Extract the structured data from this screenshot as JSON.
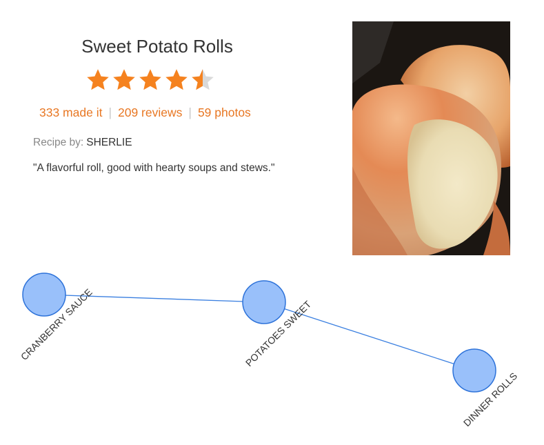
{
  "recipe": {
    "title": "Sweet Potato Rolls",
    "rating": 4.5,
    "rating_max": 5,
    "made_it": "333 made it",
    "reviews": "209 reviews",
    "photos": "59 photos",
    "by_label": "Recipe by:",
    "author": "SHERLIE",
    "description": "\"A flavorful roll, good with hearty soups and stews.\""
  },
  "colors": {
    "accent": "#e87723",
    "star_filled": "#f5821f",
    "star_empty": "#d9d9d9",
    "node_fill": "#99c0fa",
    "node_stroke": "#2d72d9",
    "edge": "#3a7fe0"
  },
  "graph": {
    "nodes": [
      "CRANBERRY SAUCE",
      "POTATOES SWEET",
      "DINNER ROLLS"
    ],
    "edges": [
      [
        "CRANBERRY SAUCE",
        "POTATOES SWEET"
      ],
      [
        "POTATOES SWEET",
        "DINNER ROLLS"
      ]
    ]
  }
}
